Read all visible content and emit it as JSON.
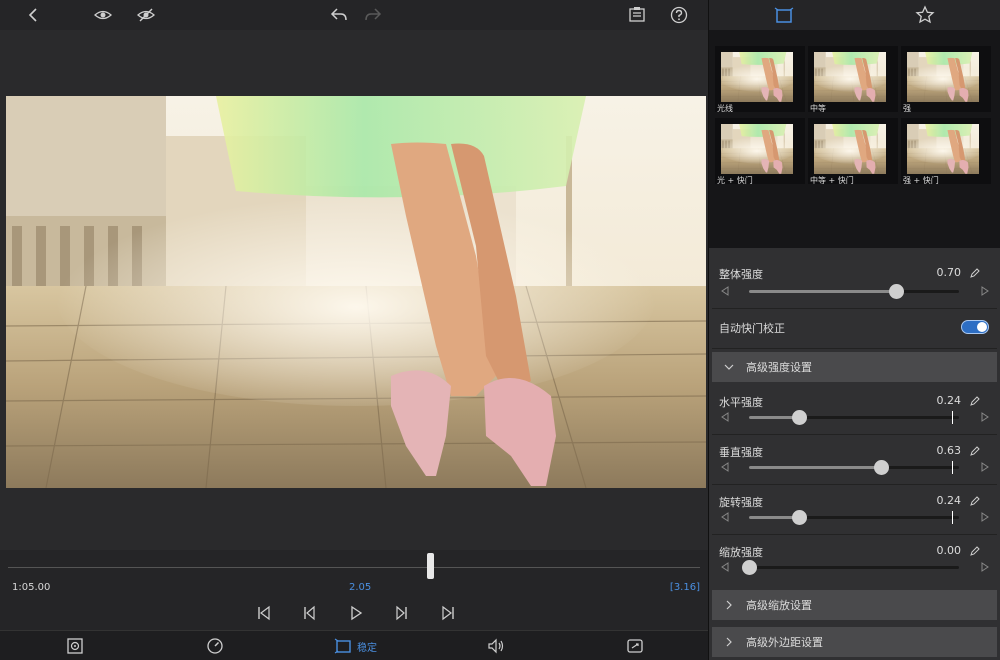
{
  "playback": {
    "current_time": "1:05.00",
    "mid_time": "2.05",
    "end_time": "[3.16]",
    "scrub_position": 0.61
  },
  "tabs": {
    "stabilize_label": "稳定",
    "active_color": "#4a8fe0"
  },
  "presets": [
    {
      "label": "光线"
    },
    {
      "label": "中等"
    },
    {
      "label": "强"
    },
    {
      "label": "光 + 快门"
    },
    {
      "label": "中等 + 快门"
    },
    {
      "label": "强 + 快门"
    }
  ],
  "settings": {
    "overall": {
      "label": "整体强度",
      "value": "0.70",
      "level": 0.7
    },
    "auto_shutter": {
      "label": "自动快门校正",
      "enabled": true
    },
    "advanced_strength": {
      "label": "高级强度设置",
      "expanded": true
    },
    "horizontal": {
      "label": "水平强度",
      "value": "0.24",
      "level": 0.24
    },
    "vertical": {
      "label": "垂直强度",
      "value": "0.63",
      "level": 0.63
    },
    "rotation": {
      "label": "旋转强度",
      "value": "0.24",
      "level": 0.24
    },
    "zoom": {
      "label": "缩放强度",
      "value": "0.00",
      "level": 0.0
    },
    "advanced_zoom": {
      "label": "高级缩放设置",
      "expanded": false
    },
    "advanced_margin": {
      "label": "高级外边距设置",
      "expanded": false
    }
  },
  "icons": [
    "back-icon",
    "eye-icon",
    "eye-off-icon",
    "undo-icon",
    "redo-icon",
    "info-panel-icon",
    "help-icon",
    "frame-icon",
    "star-icon",
    "skip-start-icon",
    "step-back-icon",
    "play-icon",
    "step-forward-icon",
    "skip-end-icon",
    "crop-target-icon",
    "speed-icon",
    "stabilize-icon",
    "audio-icon",
    "transform-icon",
    "pencil-icon",
    "chevron-down-icon",
    "chevron-right-icon"
  ]
}
